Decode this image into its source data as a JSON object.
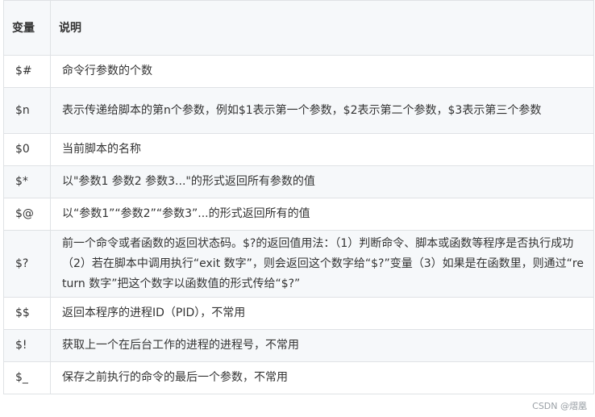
{
  "header": {
    "col_variable": "变量",
    "col_description": "说明"
  },
  "rows": [
    {
      "var": "$#",
      "desc": "命令行参数的个数"
    },
    {
      "var": "$n",
      "desc": "表示传递给脚本的第n个参数，例如$1表示第一个参数，$2表示第二个参数，$3表示第三个参数"
    },
    {
      "var": "$0",
      "desc": "当前脚本的名称"
    },
    {
      "var": "$*",
      "desc": "以\"参数1 参数2 参数3...\"的形式返回所有参数的值"
    },
    {
      "var": "$@",
      "desc": "以“参数1”“参数2”“参数3”...的形式返回所有的值"
    },
    {
      "var": "$?",
      "desc": "前一个命令或者函数的返回状态码。$?的返回值用法：（1）判断命令、脚本或函数等程序是否执行成功（2）若在脚本中调用执行“exit 数字”，则会返回这个数字给“$?”变量（3）如果是在函数里，则通过“return 数字”把这个数字以函数值的形式传给“$?”"
    },
    {
      "var": "$$",
      "desc": "返回本程序的进程ID（PID），不常用"
    },
    {
      "var": "$!",
      "desc": "获取上一个在后台工作的进程的进程号，不常用"
    },
    {
      "var": "$_",
      "desc": "保存之前执行的命令的最后一个参数，不常用"
    }
  ],
  "watermark": "CSDN @熠凰"
}
